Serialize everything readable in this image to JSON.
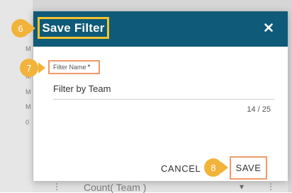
{
  "background": {
    "left_letters": [
      "M",
      "M",
      "M",
      "M",
      "0"
    ],
    "bottom_text": "Count( Team )"
  },
  "dialog": {
    "title": "Save Filter",
    "close_icon": "close-icon",
    "field": {
      "label": "Filter Name",
      "required_mark": "*",
      "value": "Filter by Team",
      "counter": "14 / 25"
    },
    "cancel_label": "CANCEL",
    "save_label": "SAVE"
  },
  "callouts": [
    "6",
    "7",
    "8"
  ],
  "colors": {
    "header_bg": "#0e5a78",
    "highlight_yellow": "#f2c12e",
    "highlight_orange": "#f09a6a",
    "badge": "#f2b33a"
  }
}
